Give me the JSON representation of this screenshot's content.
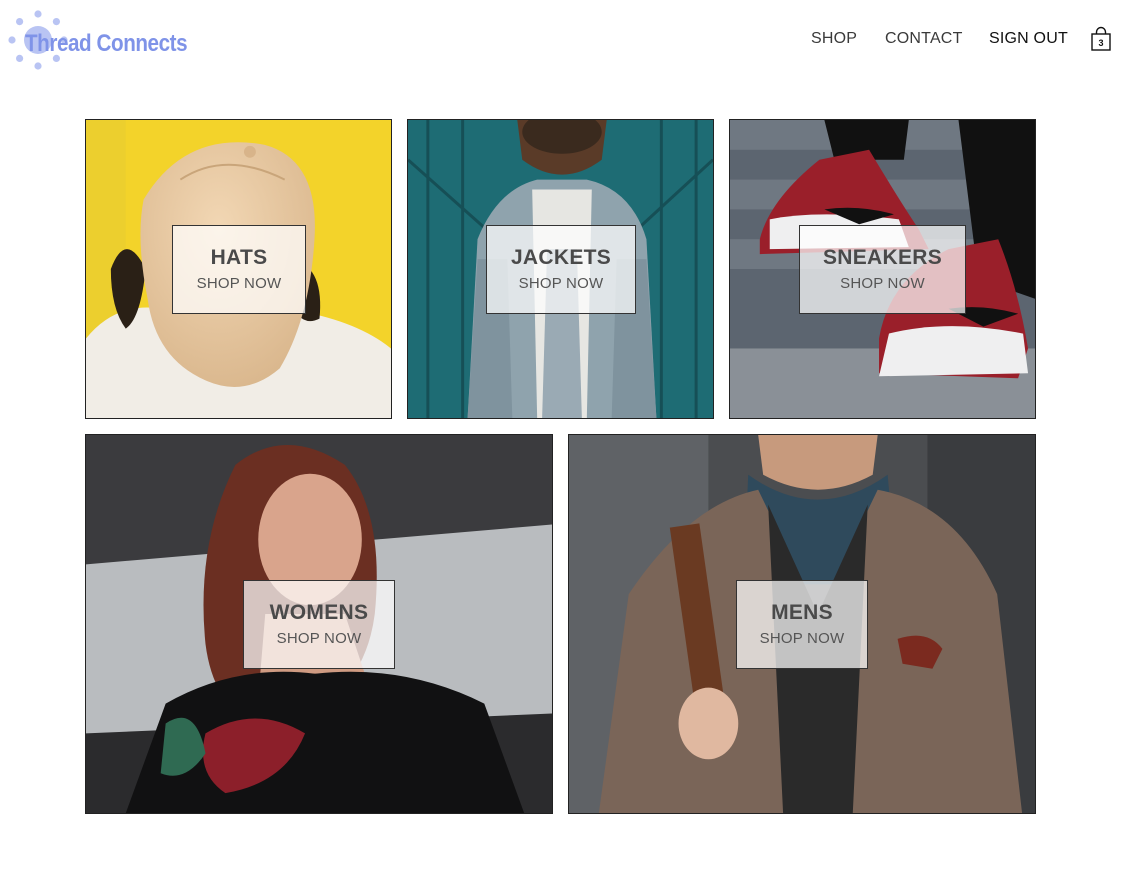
{
  "brand": {
    "name": "Thread Connects",
    "color": "#7f93e8"
  },
  "nav": {
    "shop": "SHOP",
    "contact": "CONTACT",
    "sign_out": "SIGN OUT",
    "cart_icon": "shopping-bag-icon",
    "cart_count": "3"
  },
  "categories": [
    {
      "title": "HATS",
      "cta": "SHOP NOW"
    },
    {
      "title": "JACKETS",
      "cta": "SHOP NOW"
    },
    {
      "title": "SNEAKERS",
      "cta": "SHOP NOW"
    },
    {
      "title": "WOMENS",
      "cta": "SHOP NOW"
    },
    {
      "title": "MENS",
      "cta": "SHOP NOW"
    }
  ]
}
